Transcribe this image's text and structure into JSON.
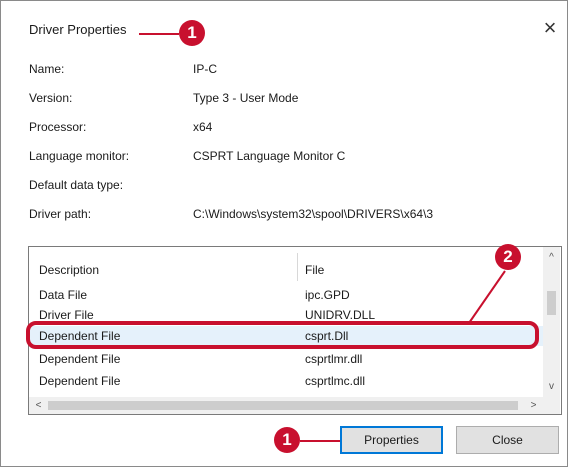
{
  "window": {
    "title": "Driver Properties",
    "close_glyph": "×"
  },
  "callouts": {
    "title": "1",
    "list": "2",
    "button": "1"
  },
  "properties": [
    {
      "label": "Name:",
      "value": "IP-C"
    },
    {
      "label": "Version:",
      "value": "Type 3 - User Mode"
    },
    {
      "label": "Processor:",
      "value": "x64"
    },
    {
      "label": "Language monitor:",
      "value": "CSPRT Language Monitor C"
    },
    {
      "label": "Default data type:",
      "value": ""
    },
    {
      "label": "Driver path:",
      "value": "C:\\Windows\\system32\\spool\\DRIVERS\\x64\\3"
    }
  ],
  "file_list": {
    "columns": {
      "description": "Description",
      "file": "File"
    },
    "rows": [
      {
        "description": "Data File",
        "file": "ipc.GPD"
      },
      {
        "description": "Driver File",
        "file": "UNIDRV.DLL"
      },
      {
        "description": "Dependent File",
        "file": "csprt.Dll",
        "selected": true
      },
      {
        "description": "Dependent File",
        "file": "csprtlmr.dll"
      },
      {
        "description": "Dependent File",
        "file": "csprtlmc.dll"
      }
    ],
    "scroll_up": "^",
    "scroll_down": "v",
    "scroll_left": "<",
    "scroll_right": ">"
  },
  "buttons": {
    "properties": "Properties",
    "close": "Close"
  },
  "colors": {
    "callout": "#c8102e",
    "selection": "#e5f1fb",
    "default_button_border": "#0078d7"
  },
  "icons": [
    "close-icon",
    "scroll-up-icon",
    "scroll-down-icon",
    "scroll-left-icon",
    "scroll-right-icon"
  ]
}
